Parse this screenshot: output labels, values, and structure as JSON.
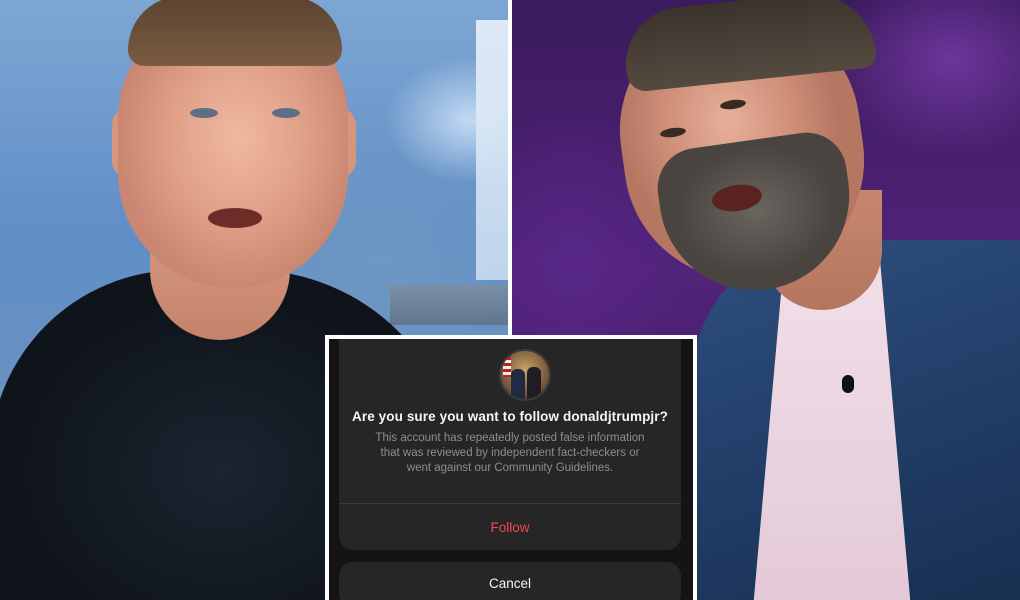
{
  "dialog": {
    "title": "Are you sure you want to follow donaldjtrumpjr?",
    "message": "This account has repeatedly posted false information that was reviewed by independent fact-checkers or went against our Community Guidelines.",
    "follow_label": "Follow",
    "cancel_label": "Cancel",
    "colors": {
      "sheet_background": "#262626",
      "follow_text": "#ed4956",
      "message_text": "#8e8e8e"
    }
  },
  "photos": {
    "left": {
      "icon": "portrait-photo"
    },
    "right": {
      "icon": "portrait-photo"
    }
  }
}
